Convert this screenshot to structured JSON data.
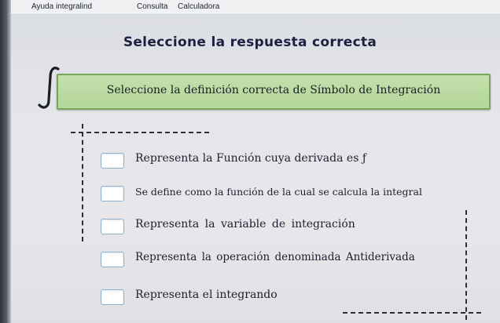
{
  "menu": {
    "items": [
      {
        "label": "Ayuda integralind"
      },
      {
        "label": "Consulta"
      },
      {
        "label": "Calculadora"
      }
    ]
  },
  "title": "Seleccione la respuesta correcta",
  "question": "Seleccione la definición correcta de Símbolo de Integración",
  "options": [
    {
      "label": "Representa la Función cuya derivada es ƒ"
    },
    {
      "label": "Se define como la función de la cual se calcula la integral"
    },
    {
      "label": "Representa la variable de integración"
    },
    {
      "label": "Representa la operación denominada Antiderivada"
    },
    {
      "label": "Representa el integrando"
    }
  ]
}
